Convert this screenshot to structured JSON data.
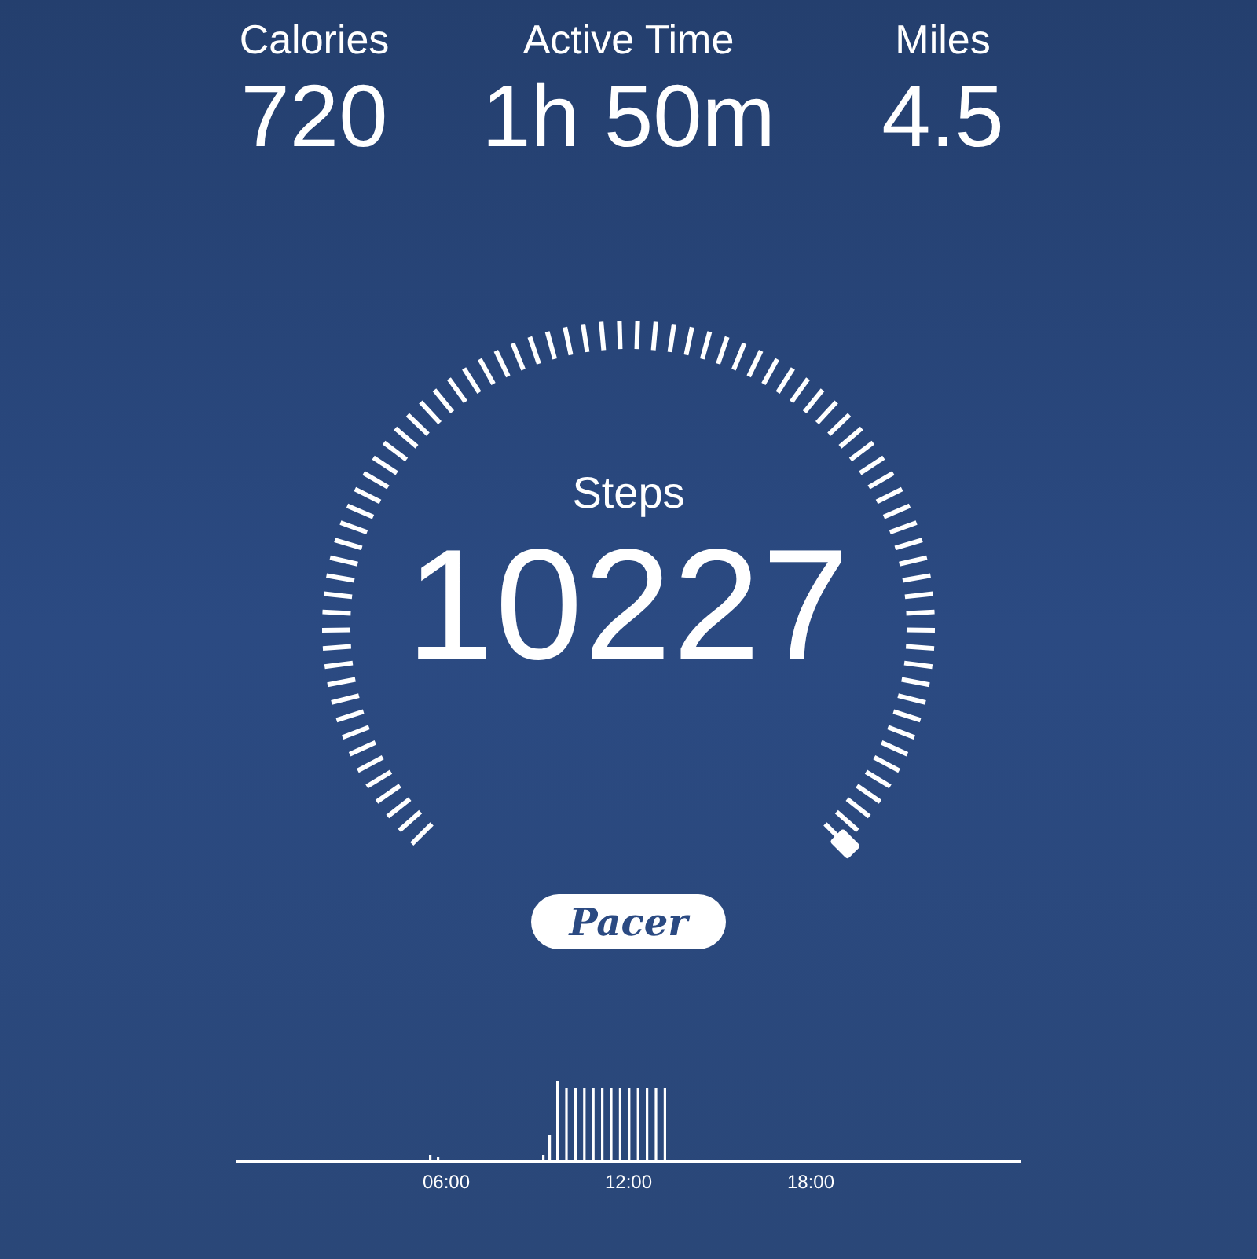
{
  "stats": [
    {
      "label": "Calories",
      "value": "720"
    },
    {
      "label": "Active Time",
      "value": "1h 50m"
    },
    {
      "label": "Miles",
      "value": "4.5"
    }
  ],
  "steps": {
    "label": "Steps",
    "value": "10227"
  },
  "brand": "Pacer",
  "activity_chart": {
    "x_labels": [
      "06:00",
      "12:00",
      "18:00"
    ]
  }
}
